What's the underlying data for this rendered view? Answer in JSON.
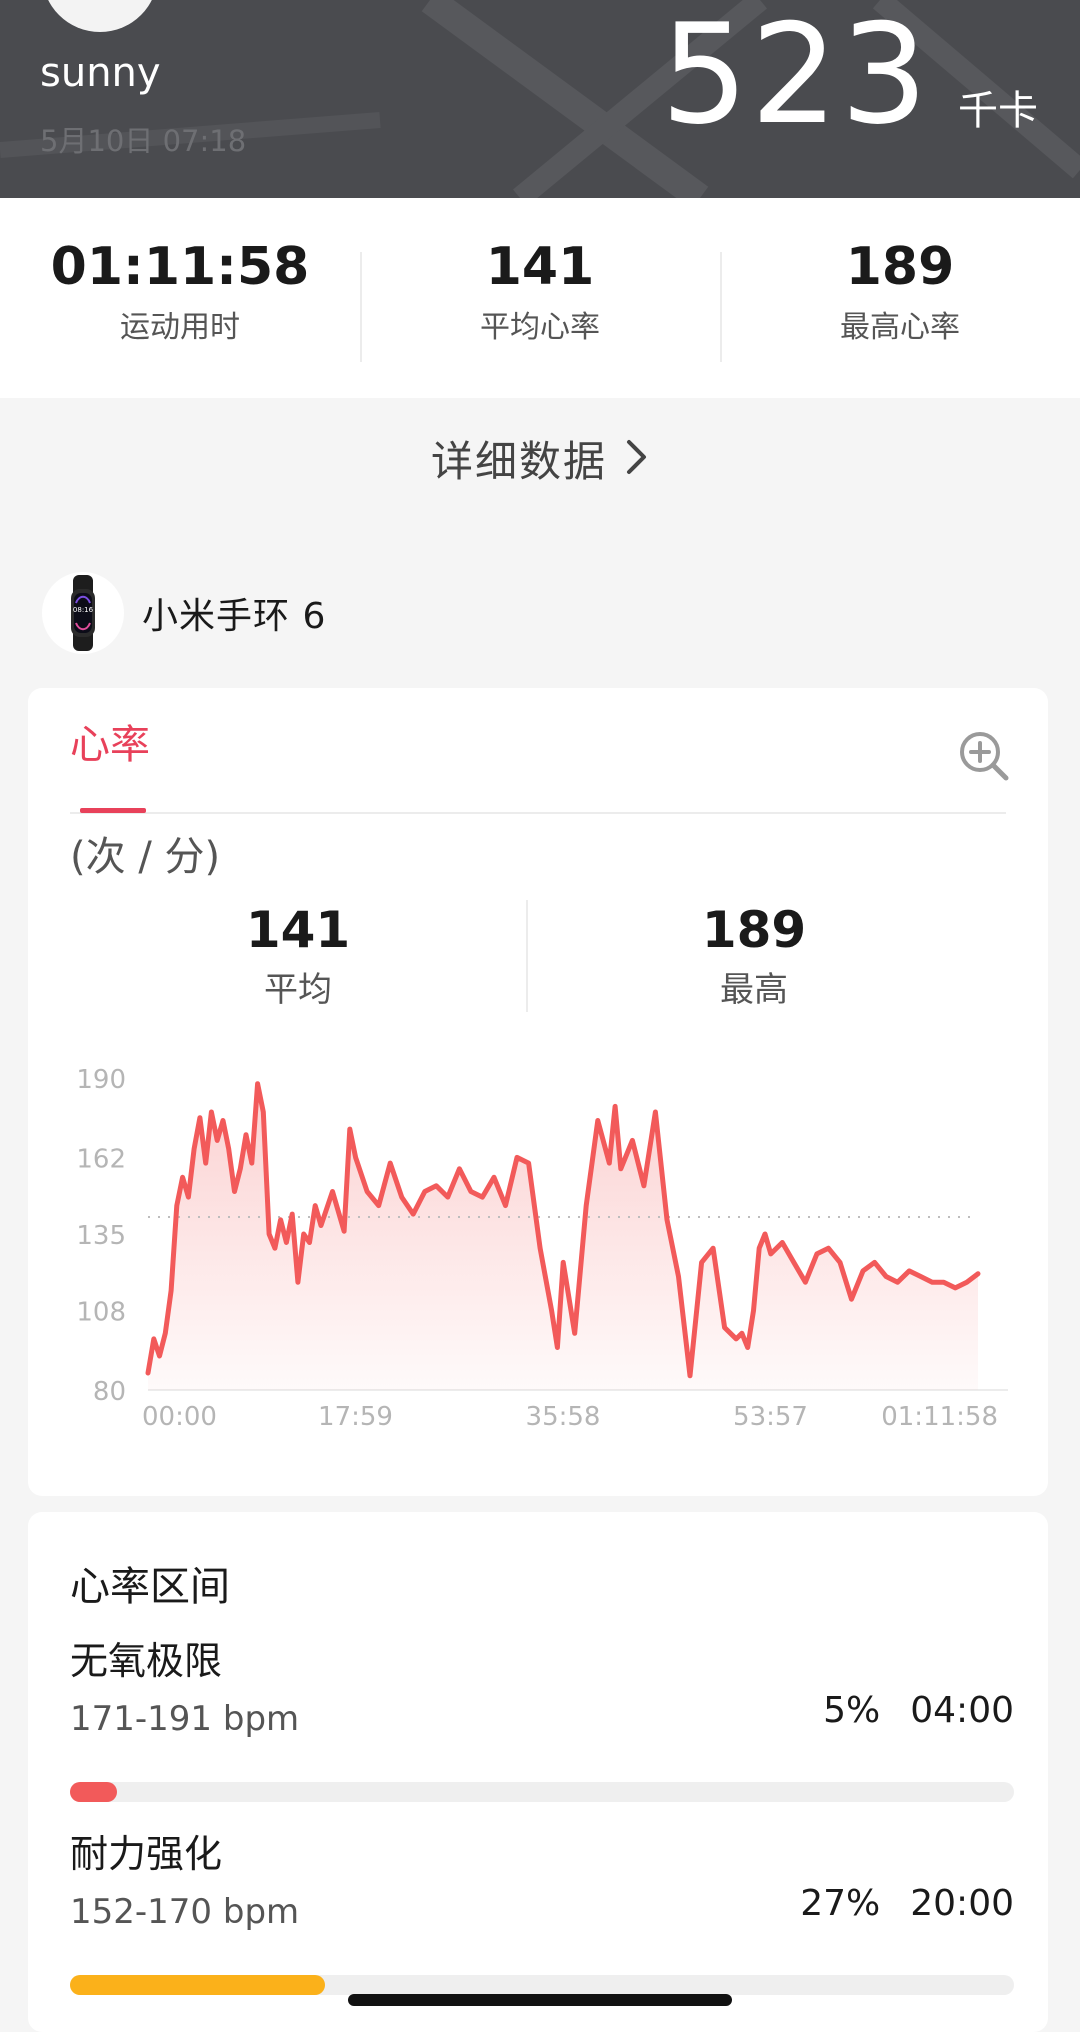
{
  "header": {
    "username": "sunny",
    "datetime": "5月10日 07:18",
    "calories_value": "523",
    "calories_unit": "千卡",
    "background_color": "#4a4b4f"
  },
  "summary": {
    "stats": [
      {
        "value": "01:11:58",
        "label": "运动用时"
      },
      {
        "value": "141",
        "label": "平均心率"
      },
      {
        "value": "189",
        "label": "最高心率"
      }
    ],
    "details_link": "详细数据",
    "details_icon": "chevron-right-icon"
  },
  "device": {
    "name": "小米手环 6",
    "icon": "fitness-band-icon",
    "screen_time": "08:16"
  },
  "heart_rate_card": {
    "tab_label": "心率",
    "accent_color": "#e8415a",
    "zoom_icon": "zoom-in-icon",
    "unit": "(次 / 分)",
    "avg": {
      "value": "141",
      "label": "平均"
    },
    "max": {
      "value": "189",
      "label": "最高"
    }
  },
  "chart_data": {
    "type": "area",
    "title": "",
    "xlabel": "",
    "ylabel": "",
    "x_tick_labels": [
      "00:00",
      "17:59",
      "35:58",
      "53:57",
      "01:11:58"
    ],
    "y_ticks": [
      190,
      162,
      135,
      108,
      80
    ],
    "ylim": [
      80,
      190
    ],
    "x_unit": "minutes",
    "xlim": [
      0,
      71.97
    ],
    "reference_line": 141,
    "grid": false,
    "line_color": "#f25a5a",
    "series": [
      {
        "x": [
          0,
          0.5,
          1,
          1.5,
          2,
          2.5,
          3,
          3.5,
          4,
          4.5,
          5,
          5.5,
          6,
          6.5,
          7,
          7.5,
          8,
          8.5,
          9,
          9.5,
          10,
          10.5,
          11,
          11.5,
          12,
          12.5,
          13,
          13.5,
          14,
          14.5,
          15,
          16,
          17,
          17.5,
          18,
          19,
          20,
          21,
          22,
          23,
          24,
          25,
          26,
          27,
          28,
          29,
          30,
          31,
          32,
          33,
          34,
          35,
          35.5,
          36,
          37,
          38,
          38.5,
          39,
          40,
          40.5,
          41,
          42,
          43,
          44,
          45,
          46,
          47,
          48,
          49,
          50,
          51,
          51.5,
          52,
          52.5,
          53,
          53.5,
          54,
          55,
          56,
          57,
          58,
          59,
          60,
          61,
          62,
          63,
          64,
          65,
          66,
          67,
          68,
          69,
          70,
          71,
          71.97
        ],
        "values": [
          86,
          98,
          92,
          100,
          115,
          145,
          155,
          148,
          165,
          176,
          160,
          178,
          168,
          175,
          165,
          150,
          158,
          170,
          160,
          188,
          178,
          135,
          130,
          140,
          132,
          142,
          118,
          135,
          132,
          145,
          138,
          150,
          136,
          172,
          162,
          150,
          145,
          160,
          148,
          142,
          150,
          152,
          148,
          158,
          150,
          148,
          155,
          145,
          162,
          160,
          130,
          108,
          95,
          125,
          100,
          145,
          160,
          175,
          160,
          180,
          158,
          168,
          152,
          178,
          140,
          120,
          85,
          125,
          130,
          102,
          98,
          100,
          95,
          108,
          130,
          135,
          128,
          132,
          125,
          118,
          128,
          130,
          125,
          112,
          122,
          125,
          120,
          118,
          122,
          120,
          118,
          118,
          116,
          118,
          121
        ],
        "color": "#f25a5a"
      }
    ]
  },
  "zones": {
    "title": "心率区间",
    "items": [
      {
        "name": "无氧极限",
        "range": "171-191 bpm",
        "percent": "5%",
        "time": "04:00",
        "fraction": 0.05,
        "color": "#f25a5a"
      },
      {
        "name": "耐力强化",
        "range": "152-170 bpm",
        "percent": "27%",
        "time": "20:00",
        "fraction": 0.27,
        "color": "#fbb11a"
      }
    ]
  }
}
